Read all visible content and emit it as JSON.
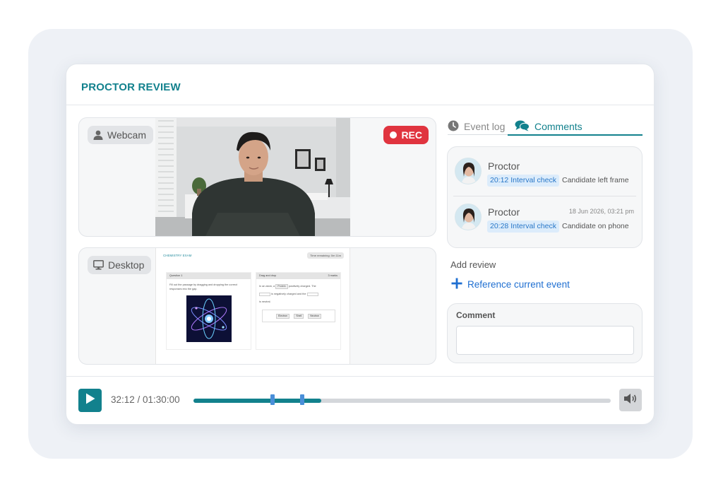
{
  "header": {
    "title": "PROCTOR REVIEW"
  },
  "webcam": {
    "label": "Webcam",
    "icon": "user-icon",
    "rec_label": "REC"
  },
  "desktop": {
    "label": "Desktop",
    "icon": "monitor-icon",
    "screen": {
      "exam_title": "CHEMISTRY EXAM",
      "timer": "Time remaining: 0m 11m",
      "question_header": "Question 1",
      "question_text": "Fill out the passage by dragging and dropping the correct responses into the gap.",
      "drag_header": "Drag and drop",
      "drag_marks": "3 marks",
      "passage_part1": "In an atom, a",
      "passage_chip": "Protein",
      "passage_part2": "positively charged. The",
      "passage_part3": "is negatively charged and the",
      "passage_part4": "is neutral.",
      "bank": [
        "Electron",
        "Shell",
        "Neutron"
      ]
    }
  },
  "tabs": {
    "event_log": "Event log",
    "comments": "Comments"
  },
  "comments": [
    {
      "name": "Proctor",
      "date": "",
      "tag": "20:12 Interval check",
      "text": "Candidate left frame"
    },
    {
      "name": "Proctor",
      "date": "18 Jun 2026, 03:21 pm",
      "tag": "20:28 Interval check",
      "text": "Candidate on phone"
    }
  ],
  "review": {
    "add_review_label": "Add review",
    "reference_label": "Reference current event",
    "comment_label": "Comment",
    "comment_value": ""
  },
  "player": {
    "time": "32:12 / 01:30:00",
    "progress": 0.307,
    "markers": [
      0.19,
      0.26
    ]
  },
  "colors": {
    "accent": "#12818d",
    "rec": "#e0343f",
    "link": "#1f6fd1",
    "tag_bg": "#dcecfb"
  }
}
